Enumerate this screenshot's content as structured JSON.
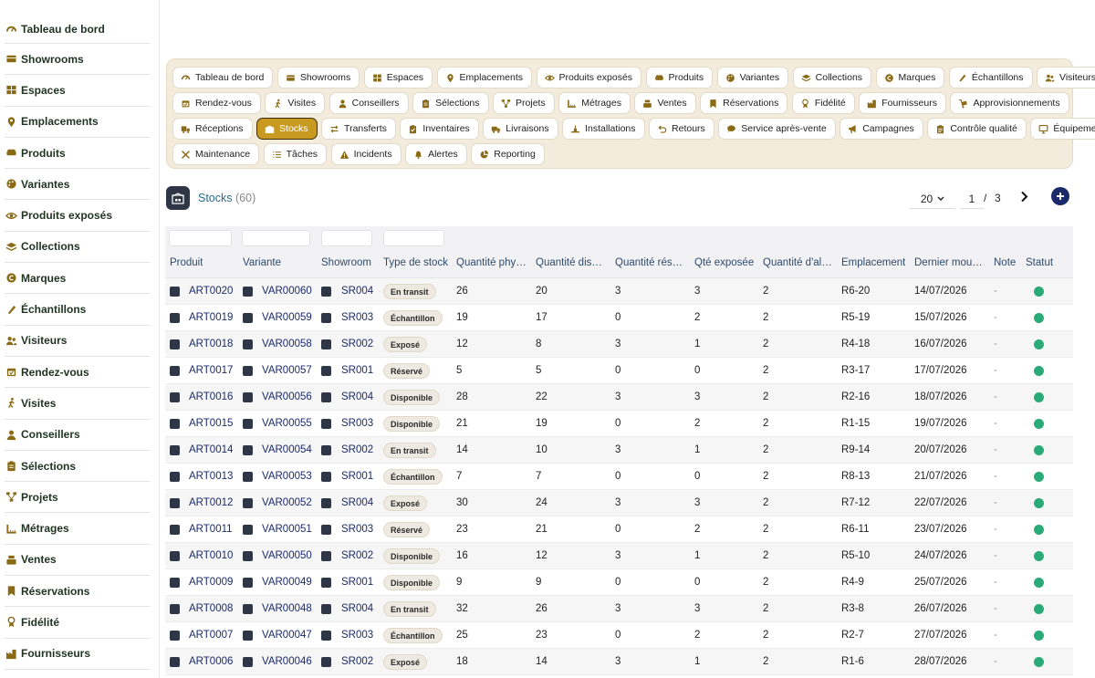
{
  "sidebar": {
    "items": [
      {
        "label": "Tableau de bord",
        "icon": "gauge-icon"
      },
      {
        "label": "Showrooms",
        "icon": "store-icon"
      },
      {
        "label": "Espaces",
        "icon": "grid-icon"
      },
      {
        "label": "Emplacements",
        "icon": "pin-icon"
      },
      {
        "label": "Produits",
        "icon": "sofa-icon"
      },
      {
        "label": "Variantes",
        "icon": "palette-icon"
      },
      {
        "label": "Produits exposés",
        "icon": "eye-icon"
      },
      {
        "label": "Collections",
        "icon": "layers-icon"
      },
      {
        "label": "Marques",
        "icon": "copyright-icon"
      },
      {
        "label": "Échantillons",
        "icon": "swatch-icon"
      },
      {
        "label": "Visiteurs",
        "icon": "users-icon"
      },
      {
        "label": "Rendez-vous",
        "icon": "calendar-icon"
      },
      {
        "label": "Visites",
        "icon": "walking-icon"
      },
      {
        "label": "Conseillers",
        "icon": "user-tie-icon"
      },
      {
        "label": "Sélections",
        "icon": "clipboard-icon"
      },
      {
        "label": "Projets",
        "icon": "project-icon"
      },
      {
        "label": "Métrages",
        "icon": "ruler-icon"
      },
      {
        "label": "Ventes",
        "icon": "cash-register-icon"
      },
      {
        "label": "Réservations",
        "icon": "bookmark-icon"
      },
      {
        "label": "Fidélité",
        "icon": "award-icon"
      },
      {
        "label": "Fournisseurs",
        "icon": "industry-icon"
      }
    ]
  },
  "nav": {
    "rows": [
      [
        {
          "label": "Tableau de bord",
          "icon": "gauge-icon"
        },
        {
          "label": "Showrooms",
          "icon": "store-icon"
        },
        {
          "label": "Espaces",
          "icon": "grid-icon"
        },
        {
          "label": "Emplacements",
          "icon": "pin-icon"
        },
        {
          "label": "Produits exposés",
          "icon": "eye-icon"
        },
        {
          "label": "Produits",
          "icon": "sofa-icon"
        },
        {
          "label": "Variantes",
          "icon": "palette-icon"
        },
        {
          "label": "Collections",
          "icon": "layers-icon"
        },
        {
          "label": "Marques",
          "icon": "copyright-icon"
        },
        {
          "label": "Échantillons",
          "icon": "swatch-icon"
        },
        {
          "label": "Visiteurs",
          "icon": "users-icon"
        }
      ],
      [
        {
          "label": "Rendez-vous",
          "icon": "calendar-icon"
        },
        {
          "label": "Visites",
          "icon": "walking-icon"
        },
        {
          "label": "Conseillers",
          "icon": "user-tie-icon"
        },
        {
          "label": "Sélections",
          "icon": "clipboard-icon"
        },
        {
          "label": "Projets",
          "icon": "project-icon"
        },
        {
          "label": "Métrages",
          "icon": "ruler-icon"
        },
        {
          "label": "Ventes",
          "icon": "cash-register-icon"
        },
        {
          "label": "Réservations",
          "icon": "bookmark-icon"
        },
        {
          "label": "Fidélité",
          "icon": "award-icon"
        },
        {
          "label": "Fournisseurs",
          "icon": "industry-icon"
        },
        {
          "label": "Approvisionnements",
          "icon": "dolly-icon"
        }
      ],
      [
        {
          "label": "Réceptions",
          "icon": "truck-loading-icon"
        },
        {
          "label": "Stocks",
          "icon": "warehouse-icon",
          "active": true
        },
        {
          "label": "Transferts",
          "icon": "exchange-icon"
        },
        {
          "label": "Inventaires",
          "icon": "clipboard-check-icon"
        },
        {
          "label": "Livraisons",
          "icon": "truck-icon"
        },
        {
          "label": "Installations",
          "icon": "tools-icon"
        },
        {
          "label": "Retours",
          "icon": "undo-icon"
        },
        {
          "label": "Service après-vente",
          "icon": "comment-icon"
        },
        {
          "label": "Campagnes",
          "icon": "bullhorn-icon"
        },
        {
          "label": "Contrôle qualité",
          "icon": "clipboard-list-icon"
        },
        {
          "label": "Équipements",
          "icon": "monitor-icon"
        }
      ],
      [
        {
          "label": "Maintenance",
          "icon": "wrench-icon"
        },
        {
          "label": "Tâches",
          "icon": "tasks-icon"
        },
        {
          "label": "Incidents",
          "icon": "warning-icon"
        },
        {
          "label": "Alertes",
          "icon": "bell-icon"
        },
        {
          "label": "Reporting",
          "icon": "pie-chart-icon"
        }
      ]
    ]
  },
  "list": {
    "title": "Stocks",
    "count": "(60)",
    "page_size": "20",
    "page": "1",
    "page_sep": "/",
    "page_total": "3"
  },
  "table": {
    "columns": [
      "Produit",
      "Variante",
      "Showroom",
      "Type de stock",
      "Quantité phy…",
      "Quantité dis…",
      "Quantité rés…",
      "Qté exposée",
      "Quantité d'al…",
      "Emplacement",
      "Dernier mou…",
      "Note",
      "Statut"
    ],
    "rows": [
      [
        "ART0020",
        "VAR00060",
        "SR004",
        "En transit",
        "26",
        "20",
        "3",
        "3",
        "2",
        "R6-20",
        "14/07/2026",
        "-"
      ],
      [
        "ART0019",
        "VAR00059",
        "SR003",
        "Échantillon",
        "19",
        "17",
        "0",
        "2",
        "2",
        "R5-19",
        "15/07/2026",
        "-"
      ],
      [
        "ART0018",
        "VAR00058",
        "SR002",
        "Exposé",
        "12",
        "8",
        "3",
        "1",
        "2",
        "R4-18",
        "16/07/2026",
        "-"
      ],
      [
        "ART0017",
        "VAR00057",
        "SR001",
        "Réservé",
        "5",
        "5",
        "0",
        "0",
        "2",
        "R3-17",
        "17/07/2026",
        "-"
      ],
      [
        "ART0016",
        "VAR00056",
        "SR004",
        "Disponible",
        "28",
        "22",
        "3",
        "3",
        "2",
        "R2-16",
        "18/07/2026",
        "-"
      ],
      [
        "ART0015",
        "VAR00055",
        "SR003",
        "Disponible",
        "21",
        "19",
        "0",
        "2",
        "2",
        "R1-15",
        "19/07/2026",
        "-"
      ],
      [
        "ART0014",
        "VAR00054",
        "SR002",
        "En transit",
        "14",
        "10",
        "3",
        "1",
        "2",
        "R9-14",
        "20/07/2026",
        "-"
      ],
      [
        "ART0013",
        "VAR00053",
        "SR001",
        "Échantillon",
        "7",
        "7",
        "0",
        "0",
        "2",
        "R8-13",
        "21/07/2026",
        "-"
      ],
      [
        "ART0012",
        "VAR00052",
        "SR004",
        "Exposé",
        "30",
        "24",
        "3",
        "3",
        "2",
        "R7-12",
        "22/07/2026",
        "-"
      ],
      [
        "ART0011",
        "VAR00051",
        "SR003",
        "Réservé",
        "23",
        "21",
        "0",
        "2",
        "2",
        "R6-11",
        "23/07/2026",
        "-"
      ],
      [
        "ART0010",
        "VAR00050",
        "SR002",
        "Disponible",
        "16",
        "12",
        "3",
        "1",
        "2",
        "R5-10",
        "24/07/2026",
        "-"
      ],
      [
        "ART0009",
        "VAR00049",
        "SR001",
        "Disponible",
        "9",
        "9",
        "0",
        "0",
        "2",
        "R4-9",
        "25/07/2026",
        "-"
      ],
      [
        "ART0008",
        "VAR00048",
        "SR004",
        "En transit",
        "32",
        "26",
        "3",
        "3",
        "2",
        "R3-8",
        "26/07/2026",
        "-"
      ],
      [
        "ART0007",
        "VAR00047",
        "SR003",
        "Échantillon",
        "25",
        "23",
        "0",
        "2",
        "2",
        "R2-7",
        "27/07/2026",
        "-"
      ],
      [
        "ART0006",
        "VAR00046",
        "SR002",
        "Exposé",
        "18",
        "14",
        "3",
        "1",
        "2",
        "R1-6",
        "28/07/2026",
        "-"
      ]
    ]
  },
  "colors": {
    "accent": "#c89a22",
    "status_ok": "#2aaa76",
    "link": "#1b2a6b"
  }
}
